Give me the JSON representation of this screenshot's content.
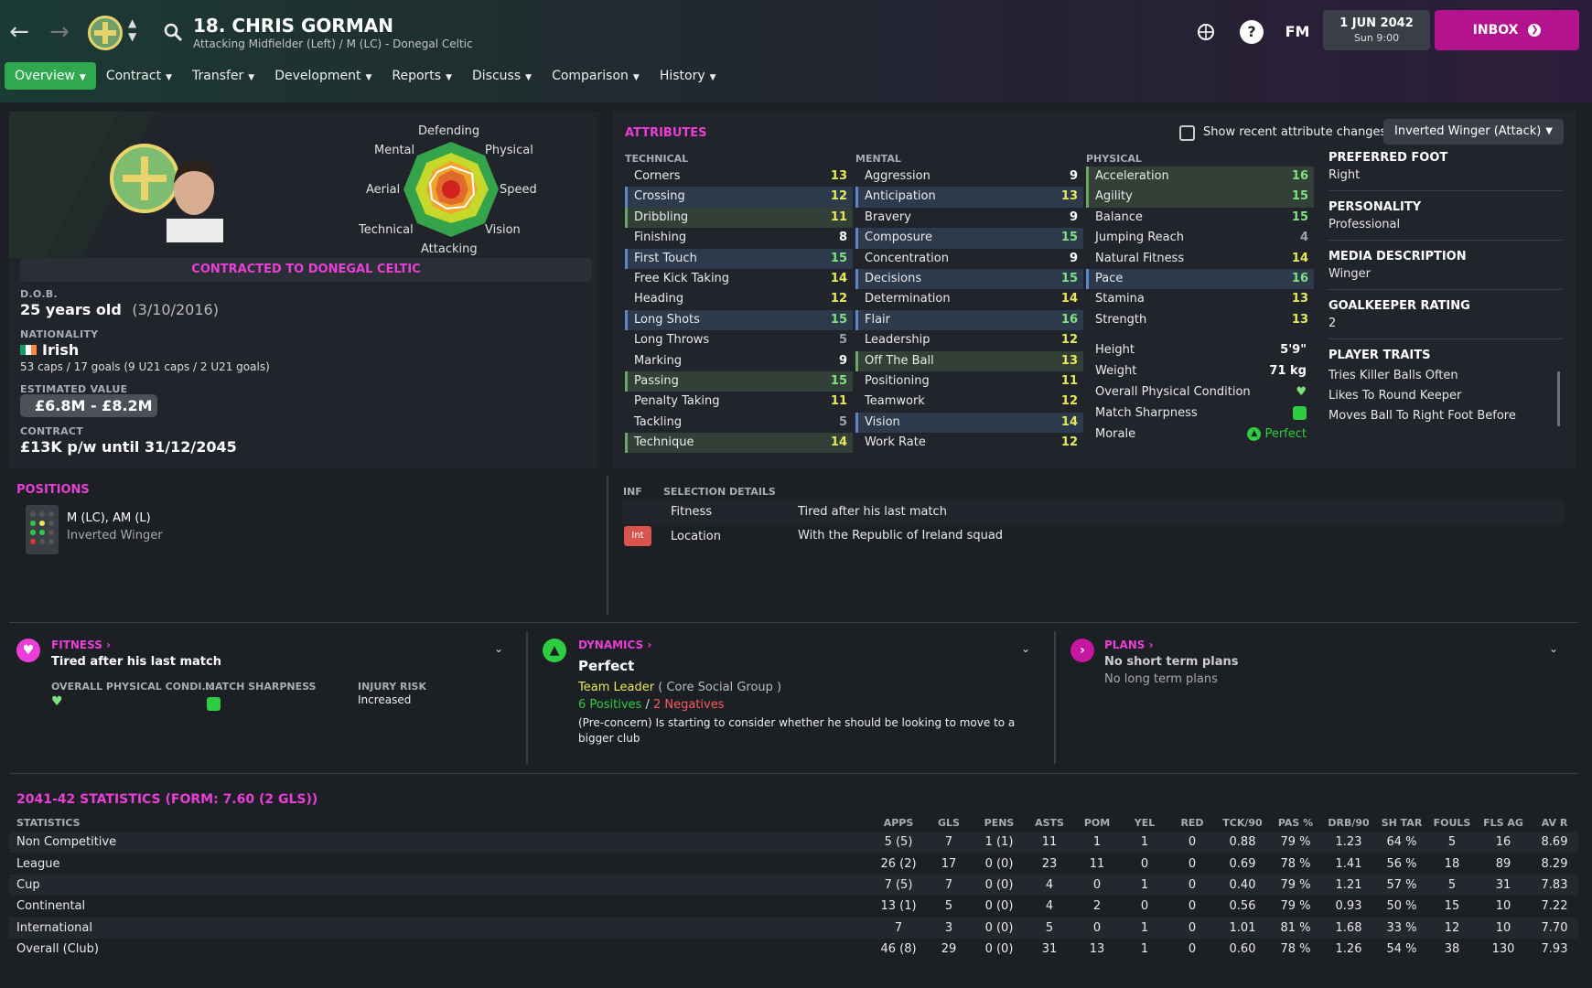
{
  "topbar": {
    "player_title": "18. CHRIS GORMAN",
    "player_subtitle": "Attacking Midfielder (Left) / M (LC) - Donegal Celtic",
    "fm_label": "FM",
    "help_label": "?",
    "date": "1 JUN 2042",
    "time": "Sun 9:00",
    "inbox_label": "INBOX"
  },
  "tabs": [
    "Overview",
    "Contract",
    "Transfer",
    "Development",
    "Reports",
    "Discuss",
    "Comparison",
    "History"
  ],
  "profile": {
    "contract_banner": "CONTRACTED TO DONEGAL CELTIC",
    "radar_labels": {
      "top": "Defending",
      "top_left": "Mental",
      "top_right": "Physical",
      "left": "Aerial",
      "right": "Speed",
      "bottom_left": "Technical",
      "bottom_right": "Vision",
      "bottom": "Attacking"
    },
    "dob_label": "D.O.B.",
    "age": "25 years old",
    "dob": "(3/10/2016)",
    "nationality_label": "NATIONALITY",
    "nationality": "Irish",
    "caps": "53 caps / 17 goals (9 U21 caps / 2 U21 goals)",
    "value_label": "ESTIMATED VALUE",
    "value": "£6.8M - £8.2M",
    "contract_label": "CONTRACT",
    "contract": "£13K p/w until 31/12/2045"
  },
  "attributes": {
    "title": "ATTRIBUTES",
    "show_changes_label": "Show recent attribute changes",
    "role": "Inverted Winger (Attack)",
    "technical_label": "TECHNICAL",
    "mental_label": "MENTAL",
    "physical_label": "PHYSICAL",
    "technical": [
      {
        "name": "Corners",
        "value": "13"
      },
      {
        "name": "Crossing",
        "value": "12"
      },
      {
        "name": "Dribbling",
        "value": "11"
      },
      {
        "name": "Finishing",
        "value": "8"
      },
      {
        "name": "First Touch",
        "value": "15"
      },
      {
        "name": "Free Kick Taking",
        "value": "14"
      },
      {
        "name": "Heading",
        "value": "12"
      },
      {
        "name": "Long Shots",
        "value": "15"
      },
      {
        "name": "Long Throws",
        "value": "5"
      },
      {
        "name": "Marking",
        "value": "9"
      },
      {
        "name": "Passing",
        "value": "15"
      },
      {
        "name": "Penalty Taking",
        "value": "11"
      },
      {
        "name": "Tackling",
        "value": "5"
      },
      {
        "name": "Technique",
        "value": "14"
      }
    ],
    "mental": [
      {
        "name": "Aggression",
        "value": "9"
      },
      {
        "name": "Anticipation",
        "value": "13"
      },
      {
        "name": "Bravery",
        "value": "9"
      },
      {
        "name": "Composure",
        "value": "15"
      },
      {
        "name": "Concentration",
        "value": "9"
      },
      {
        "name": "Decisions",
        "value": "15"
      },
      {
        "name": "Determination",
        "value": "14"
      },
      {
        "name": "Flair",
        "value": "16"
      },
      {
        "name": "Leadership",
        "value": "12"
      },
      {
        "name": "Off The Ball",
        "value": "13"
      },
      {
        "name": "Positioning",
        "value": "11"
      },
      {
        "name": "Teamwork",
        "value": "12"
      },
      {
        "name": "Vision",
        "value": "14"
      },
      {
        "name": "Work Rate",
        "value": "12"
      }
    ],
    "physical": [
      {
        "name": "Acceleration",
        "value": "16"
      },
      {
        "name": "Agility",
        "value": "15"
      },
      {
        "name": "Balance",
        "value": "15"
      },
      {
        "name": "Jumping Reach",
        "value": "4"
      },
      {
        "name": "Natural Fitness",
        "value": "14"
      },
      {
        "name": "Pace",
        "value": "16"
      },
      {
        "name": "Stamina",
        "value": "13"
      },
      {
        "name": "Strength",
        "value": "13"
      }
    ],
    "height_label": "Height",
    "height": "5'9\"",
    "weight_label": "Weight",
    "weight": "71 kg",
    "condition_label": "Overall Physical Condition",
    "sharpness_label": "Match Sharpness",
    "morale_label": "Morale",
    "morale": "Perfect"
  },
  "side": {
    "foot_label": "PREFERRED FOOT",
    "foot": "Right",
    "personality_label": "PERSONALITY",
    "personality": "Professional",
    "media_label": "MEDIA DESCRIPTION",
    "media": "Winger",
    "gk_label": "GOALKEEPER RATING",
    "gk": "2",
    "traits_label": "PLAYER TRAITS",
    "traits": [
      "Tries Killer Balls Often",
      "Likes To Round Keeper",
      "Moves Ball To Right Foot Before"
    ]
  },
  "positions": {
    "title": "POSITIONS",
    "positions": "M (LC), AM (L)",
    "role": "Inverted Winger"
  },
  "selection": {
    "inf_label": "INF",
    "details_label": "SELECTION DETAILS",
    "rows": [
      {
        "tag": "",
        "name": "Fitness",
        "detail": "Tired after his last match"
      },
      {
        "tag": "Int",
        "name": "Location",
        "detail": "With the Republic of Ireland squad"
      }
    ]
  },
  "fitness": {
    "title": "FITNESS",
    "main": "Tired after his last match",
    "condition_label": "OVERALL PHYSICAL CONDI...",
    "sharpness_label": "MATCH SHARPNESS",
    "injury_label": "INJURY RISK",
    "injury": "Increased"
  },
  "dynamics": {
    "title": "DYNAMICS",
    "main": "Perfect",
    "group_role": "Team Leader",
    "group": "( Core Social Group )",
    "positives": "6 Positives",
    "slash": "/",
    "negatives": "2 Negatives",
    "note": "(Pre-concern) Is starting to consider whether he should be looking to move to a bigger club"
  },
  "plans": {
    "title": "PLANS",
    "main": "No short term plans",
    "long": "No long term plans"
  },
  "stats": {
    "title": "2041-42 STATISTICS (FORM: 7.60 (2 GLS))",
    "headers": [
      "STATISTICS",
      "APPS",
      "GLS",
      "PENS",
      "ASTS",
      "POM",
      "YEL",
      "RED",
      "TCK/90",
      "PAS %",
      "DRB/90",
      "SH TAR",
      "FOULS",
      "FLS AG",
      "AV R"
    ],
    "rows": [
      [
        "Non Competitive",
        "5 (5)",
        "7",
        "1 (1)",
        "11",
        "1",
        "1",
        "0",
        "0.88",
        "79 %",
        "1.23",
        "64 %",
        "5",
        "16",
        "8.69"
      ],
      [
        "League",
        "26 (2)",
        "17",
        "0 (0)",
        "23",
        "11",
        "0",
        "0",
        "0.69",
        "78 %",
        "1.41",
        "56 %",
        "18",
        "89",
        "8.29"
      ],
      [
        "Cup",
        "7 (5)",
        "7",
        "0 (0)",
        "4",
        "0",
        "1",
        "0",
        "0.40",
        "79 %",
        "1.21",
        "57 %",
        "5",
        "31",
        "7.83"
      ],
      [
        "Continental",
        "13 (1)",
        "5",
        "0 (0)",
        "4",
        "2",
        "0",
        "0",
        "0.56",
        "79 %",
        "0.93",
        "50 %",
        "15",
        "10",
        "7.22"
      ],
      [
        "International",
        "7",
        "3",
        "0 (0)",
        "5",
        "0",
        "1",
        "0",
        "1.01",
        "81 %",
        "1.68",
        "33 %",
        "12",
        "10",
        "7.70"
      ],
      [
        "Overall (Club)",
        "46 (8)",
        "29",
        "0 (0)",
        "31",
        "13",
        "1",
        "0",
        "0.60",
        "78 %",
        "1.26",
        "54 %",
        "38",
        "130",
        "7.93"
      ]
    ]
  },
  "colors": {
    "accent": "#e93fd6",
    "tab_active": "#2fa84f",
    "inbox": "#b3138f",
    "good": "#2ecc40"
  }
}
